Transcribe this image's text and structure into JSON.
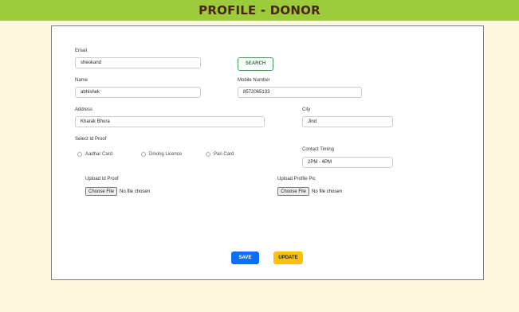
{
  "header": {
    "title": "PROFILE - DONOR"
  },
  "form": {
    "email": {
      "label": "Email",
      "value": "sheokand"
    },
    "search_label": "SEARCH",
    "name": {
      "label": "Name",
      "value": "abhishek"
    },
    "mobile": {
      "label": "Mobile Number",
      "value": "8572065133"
    },
    "address": {
      "label": "Address",
      "value": "Kharak Bhura"
    },
    "city": {
      "label": "City",
      "value": "Jind"
    },
    "id_proof": {
      "label": "Select Id Proof",
      "options": [
        "Aadhar Card",
        "Driving Licence",
        "Pan Card"
      ]
    },
    "contact_timing": {
      "label": "Contact Timing",
      "value": "2PM - 4PM"
    },
    "upload_id": {
      "label": "Upload Id Proof",
      "button": "Choose File",
      "status": "No file chosen"
    },
    "upload_pic": {
      "label": "Upload Profile Pic",
      "button": "Choose File",
      "status": "No file chosen"
    },
    "save_label": "SAVE",
    "update_label": "UPDATE"
  },
  "colors": {
    "header_bg": "#9ccc3c",
    "page_bg": "#fdf8df",
    "save": "#0d6efd",
    "update": "#ffc107",
    "search_border": "#3f9a5e"
  }
}
